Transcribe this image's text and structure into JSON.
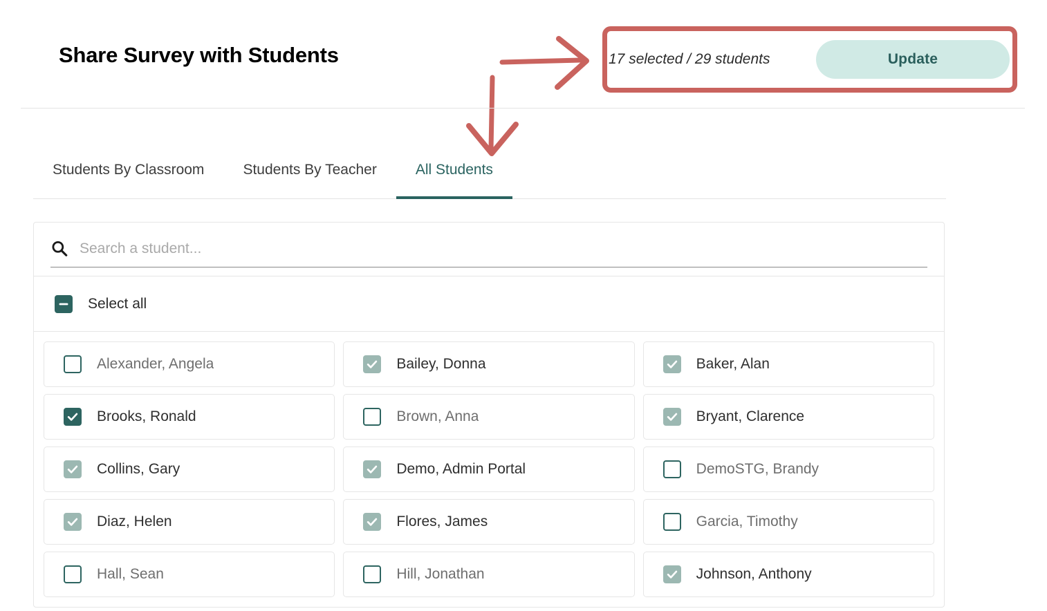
{
  "header": {
    "title": "Share Survey with Students",
    "selection_summary": "17 selected / 29 students",
    "update_label": "Update",
    "selected_count": 17,
    "total_count": 29,
    "annotation_color": "#c9635e"
  },
  "tabs": [
    {
      "label": "Students By Classroom",
      "active": false
    },
    {
      "label": "Students By Teacher",
      "active": false
    },
    {
      "label": "All Students",
      "active": true
    }
  ],
  "search": {
    "placeholder": "Search a student...",
    "value": "",
    "icon": "search-icon"
  },
  "select_all": {
    "label": "Select all",
    "state": "indeterminate"
  },
  "colors": {
    "accent_dark_teal": "#2d6460",
    "accent_muted_teal": "#9cb8b2",
    "button_mint": "#d0eae5",
    "annotation_red": "#c9635e",
    "tab_active": "#2a6360"
  },
  "students": [
    {
      "name": "Alexander, Angela",
      "state": "unchecked"
    },
    {
      "name": "Bailey, Donna",
      "state": "checked-muted"
    },
    {
      "name": "Baker, Alan",
      "state": "checked-muted"
    },
    {
      "name": "Brooks, Ronald",
      "state": "checked-strong"
    },
    {
      "name": "Brown, Anna",
      "state": "unchecked"
    },
    {
      "name": "Bryant, Clarence",
      "state": "checked-muted"
    },
    {
      "name": "Collins, Gary",
      "state": "checked-muted"
    },
    {
      "name": "Demo, Admin Portal",
      "state": "checked-muted"
    },
    {
      "name": "DemoSTG, Brandy",
      "state": "unchecked"
    },
    {
      "name": "Diaz, Helen",
      "state": "checked-muted"
    },
    {
      "name": "Flores, James",
      "state": "checked-muted"
    },
    {
      "name": "Garcia, Timothy",
      "state": "unchecked"
    },
    {
      "name": "Hall, Sean",
      "state": "unchecked"
    },
    {
      "name": "Hill, Jonathan",
      "state": "unchecked"
    },
    {
      "name": "Johnson, Anthony",
      "state": "checked-muted"
    }
  ]
}
